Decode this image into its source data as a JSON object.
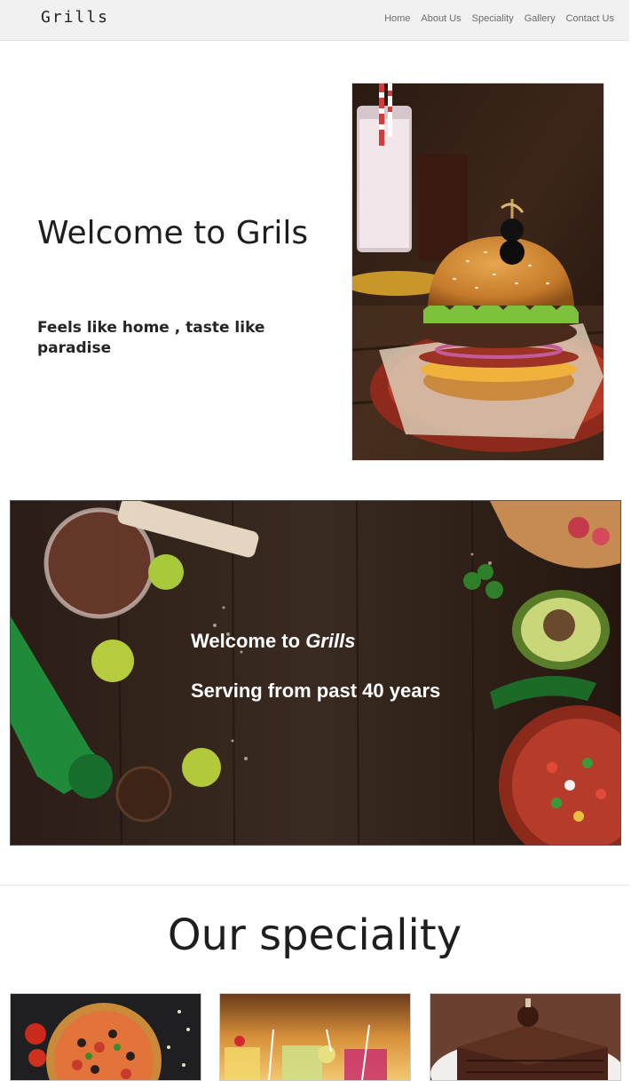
{
  "navbar": {
    "brand": "Grills",
    "links": [
      "Home",
      "About Us",
      "Speciality",
      "Gallery",
      "Contact Us"
    ]
  },
  "hero": {
    "title": "Welcome to Grils",
    "subtitle": "Feels like home , taste like paradise"
  },
  "banner": {
    "line1_prefix": "Welcome to ",
    "line1_emphasis": "Grills",
    "line2": "Serving from past 40 years"
  },
  "speciality": {
    "title": "Our speciality",
    "cards": [
      "pizza-photo",
      "cocktails-photo",
      "chocolate-cake-photo"
    ]
  }
}
